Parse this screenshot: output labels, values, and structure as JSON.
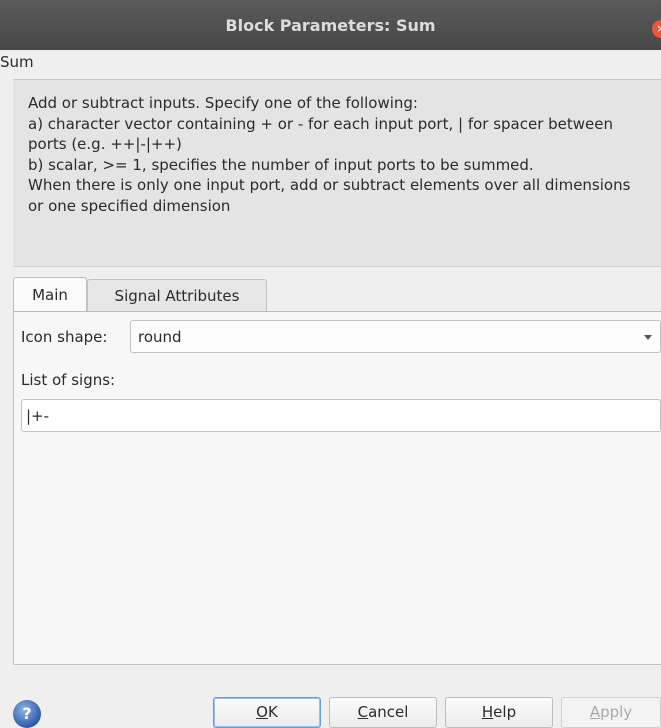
{
  "window": {
    "title": "Block Parameters: Sum",
    "close_glyph": "×"
  },
  "block": {
    "name": "Sum",
    "description": "Add or subtract inputs.  Specify one of the following:\na) character vector containing + or - for each input port, | for spacer between ports (e.g. ++|-|++)\nb) scalar, >= 1, specifies the number of input ports to be summed.\nWhen there is only one input port, add or subtract elements over all dimensions or one specified dimension"
  },
  "tabs": [
    {
      "label": "Main",
      "active": true
    },
    {
      "label": "Signal Attributes",
      "active": false
    }
  ],
  "main": {
    "icon_shape_label": "Icon shape:",
    "icon_shape_value": "round",
    "list_of_signs_label": "List of signs:",
    "list_of_signs_value": "|+-"
  },
  "buttons": {
    "ok": {
      "mnemonic": "O",
      "rest": "K"
    },
    "cancel": {
      "mnemonic": "C",
      "rest": "ancel"
    },
    "help": {
      "mnemonic": "H",
      "rest": "elp"
    },
    "apply": {
      "mnemonic": "A",
      "rest": "pply",
      "enabled": false
    }
  },
  "icons": {
    "help": "help-circle-icon",
    "close": "close-icon"
  },
  "colors": {
    "titlebar": "#4f4f4f",
    "close": "#e9573f",
    "ok_border": "#6d9ad6"
  }
}
